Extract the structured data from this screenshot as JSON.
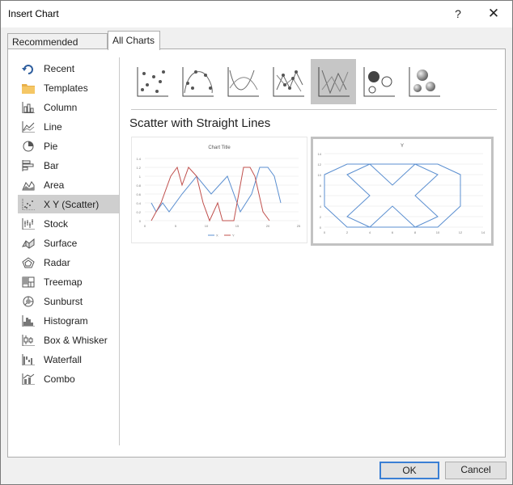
{
  "window": {
    "title": "Insert Chart",
    "help_glyph": "?",
    "close_glyph": "✕"
  },
  "tabs": [
    {
      "label": "Recommended Charts",
      "active": false
    },
    {
      "label": "All Charts",
      "active": true
    }
  ],
  "sidebar": {
    "selected": "X Y (Scatter)",
    "items": [
      {
        "label": "Recent",
        "icon": "recent-icon"
      },
      {
        "label": "Templates",
        "icon": "folder-icon"
      },
      {
        "label": "Column",
        "icon": "column-chart-icon"
      },
      {
        "label": "Line",
        "icon": "line-chart-icon"
      },
      {
        "label": "Pie",
        "icon": "pie-chart-icon"
      },
      {
        "label": "Bar",
        "icon": "bar-chart-icon"
      },
      {
        "label": "Area",
        "icon": "area-chart-icon"
      },
      {
        "label": "X Y (Scatter)",
        "icon": "scatter-chart-icon"
      },
      {
        "label": "Stock",
        "icon": "stock-chart-icon"
      },
      {
        "label": "Surface",
        "icon": "surface-chart-icon"
      },
      {
        "label": "Radar",
        "icon": "radar-chart-icon"
      },
      {
        "label": "Treemap",
        "icon": "treemap-chart-icon"
      },
      {
        "label": "Sunburst",
        "icon": "sunburst-chart-icon"
      },
      {
        "label": "Histogram",
        "icon": "histogram-chart-icon"
      },
      {
        "label": "Box & Whisker",
        "icon": "box-whisker-chart-icon"
      },
      {
        "label": "Waterfall",
        "icon": "waterfall-chart-icon"
      },
      {
        "label": "Combo",
        "icon": "combo-chart-icon"
      }
    ]
  },
  "subtypes": {
    "selected_index": 4,
    "items": [
      "scatter-markers-icon",
      "scatter-smooth-markers-icon",
      "scatter-smooth-lines-icon",
      "scatter-straight-markers-icon",
      "scatter-straight-lines-icon",
      "bubble-icon",
      "bubble-3d-icon"
    ],
    "selected_title": "Scatter with Straight Lines"
  },
  "previews": [
    {
      "title": "Chart Title",
      "y_ticks": [
        "0",
        "0.2",
        "0.4",
        "0.6",
        "0.8",
        "1",
        "1.2",
        "1.4"
      ],
      "x_ticks": [
        "0",
        "5",
        "10",
        "15",
        "20",
        "25"
      ],
      "legend": [
        "X",
        "Y"
      ],
      "colors": [
        "#5b8fd0",
        "#c0504d"
      ]
    },
    {
      "title": "Y",
      "y_ticks": [
        "0",
        "2",
        "4",
        "6",
        "8",
        "10",
        "12",
        "14"
      ],
      "x_ticks": [
        "0",
        "2",
        "4",
        "6",
        "8",
        "10",
        "12",
        "14"
      ],
      "color": "#5b8fd0"
    }
  ],
  "buttons": {
    "ok": "OK",
    "cancel": "Cancel"
  }
}
